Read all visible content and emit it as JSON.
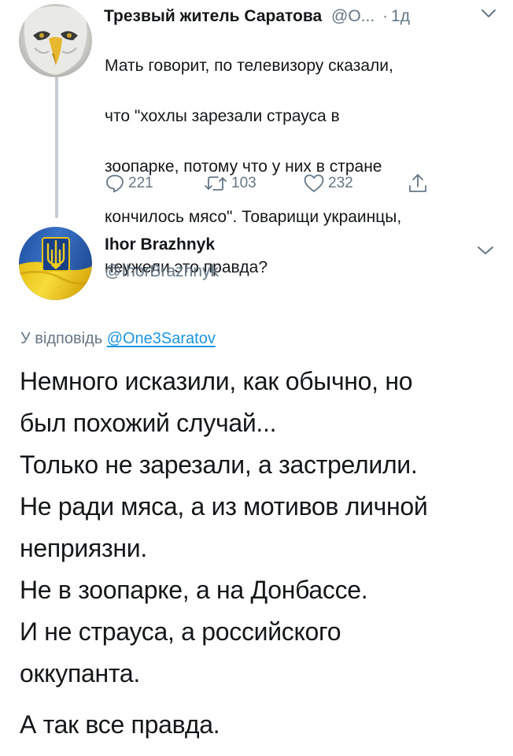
{
  "parent_tweet": {
    "author_name": "Трезвый житель Саратова",
    "handle": "@О...",
    "separator": "·",
    "time": "1д",
    "text_lines": [
      "Мать говорит, по телевизору сказали,",
      "что \"хохлы зарезали страуса в",
      "зоопарке, потому что у них в стране",
      "кончилось мясо\". Товарищи украинцы,",
      "неужели это правда?"
    ],
    "replies_count": "221",
    "retweets_count": "103",
    "likes_count": "232",
    "icons": [
      "avatar-eagle",
      "chevron-down-icon",
      "reply-icon",
      "retweet-icon",
      "like-icon",
      "share-icon"
    ]
  },
  "reply_tweet": {
    "author_name": "Ihor Brazhnyk",
    "handle": "@IhorBrazhnyk",
    "replying_to_prefix": "У відповідь",
    "replying_to_mention": "@One3Saratov",
    "body_lines": [
      "Немного исказили, как обычно, но",
      "был похожий случай...",
      "Только не зарезали, а застрелили.",
      "Не ради мяса, а из мотивов личной",
      "неприязни.",
      "Не в зоопарке, а на Донбассе.",
      "И не страуса, а российского",
      "оккупанта.",
      "А так все правда."
    ],
    "colors": {
      "link": "#1b95e0",
      "secondary": "#657786",
      "flag_blue": "#2a5fb0",
      "flag_yellow": "#f3d21a"
    }
  }
}
